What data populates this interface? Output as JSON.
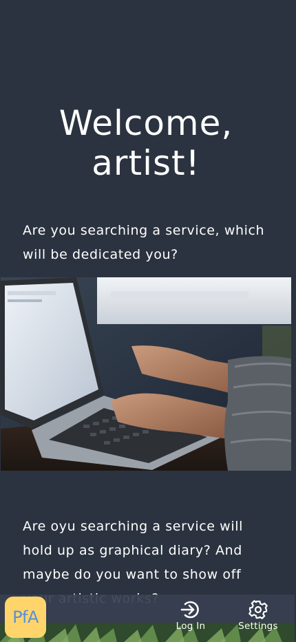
{
  "header": {
    "title": "Welcome, artist!"
  },
  "intro": {
    "paragraph_1": "Are you searching a service, which will be dedicated you?",
    "paragraph_2": "Are oyu searching a service will hold up as graphical diary? And maybe do you want to show off your artistic works?"
  },
  "hero_image": {
    "subject": "hands typing on a laptop"
  },
  "bottom_nav": {
    "logo_text": "PfA",
    "items": [
      {
        "label": "Log In",
        "icon": "login-icon"
      },
      {
        "label": "Settings",
        "icon": "gear-icon"
      }
    ]
  },
  "colors": {
    "background": "#2b3340",
    "logo_bg": "#ffd56b",
    "logo_text": "#5a8fd6",
    "text": "#ffffff"
  }
}
